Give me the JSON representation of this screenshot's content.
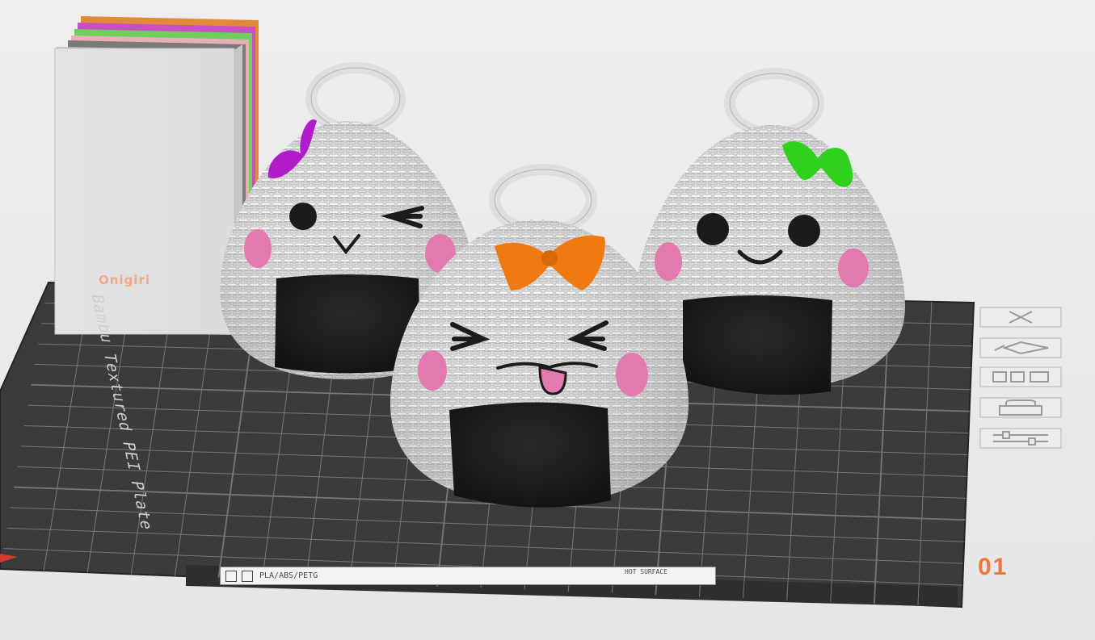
{
  "scene": {
    "tower_label": "Onigiri",
    "plate_name": "Bambu Textured PEI Plate",
    "plate_number": "01",
    "filament_text": "PLA/ABS/PETG",
    "surface_text": "HOT SURFACE",
    "colors": {
      "background": "#e9e9ea",
      "plate": "#3a3b3c",
      "grid": "#8a8b8c",
      "rice": "#e4e4e4",
      "nori": "#1c1c1c",
      "cheek": "#e27ab0",
      "bow_purple": "#b21bc9",
      "bow_orange": "#ef7a12",
      "bow_green": "#2fd11c",
      "accent": "#f0773b"
    },
    "onigiri": [
      {
        "name": "left",
        "expression": "wink",
        "bow_color": "purple"
      },
      {
        "name": "center",
        "expression": "laughing with tongue out",
        "bow_color": "orange"
      },
      {
        "name": "right",
        "expression": "smile",
        "bow_color": "green"
      }
    ]
  },
  "tools": [
    {
      "name": "close-plate",
      "icon": "close-x-icon"
    },
    {
      "name": "auto-orient",
      "icon": "auto-orient-icon"
    },
    {
      "name": "arrange",
      "icon": "arrange-icon"
    },
    {
      "name": "lock",
      "icon": "lock-icon"
    },
    {
      "name": "plate-settings",
      "icon": "settings-icon"
    }
  ]
}
